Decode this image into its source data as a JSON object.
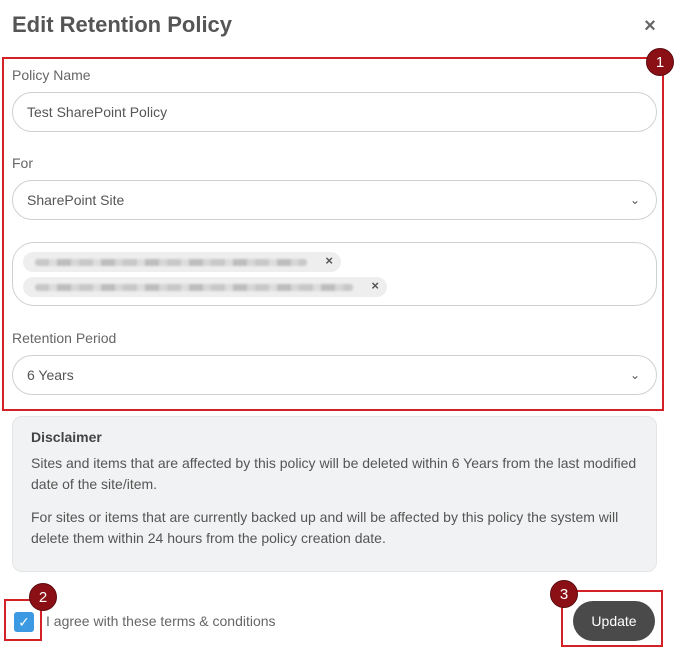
{
  "dialog": {
    "title": "Edit Retention Policy",
    "close_symbol": "×"
  },
  "form": {
    "policy_name_label": "Policy Name",
    "policy_name_value": "Test SharePoint Policy",
    "for_label": "For",
    "for_value": "SharePoint Site",
    "selected_sites_note": "Two selected site tags (text blurred)",
    "retention_period_label": "Retention Period",
    "retention_period_value": "6 Years",
    "chevron_icon": "chevron-down-icon",
    "tag_remove_symbol": "×"
  },
  "disclaimer": {
    "heading": "Disclaimer",
    "paragraph1": "Sites and items that are affected by this policy will be deleted within 6 Years from the last modified date of the site/item.",
    "paragraph2": "For sites or items that are currently backed up and will be affected by this policy the system will delete them within 24 hours from the policy creation date."
  },
  "footer": {
    "agree_label": "I agree with these terms & conditions",
    "agree_checked": true,
    "update_label": "Update"
  },
  "annotations": {
    "markers": [
      "1",
      "2",
      "3"
    ],
    "highlight_color": "#d42027",
    "marker_color": "#8b1016"
  },
  "colors": {
    "checkbox": "#3b9ae1",
    "update_button": "#4a4a4a"
  }
}
